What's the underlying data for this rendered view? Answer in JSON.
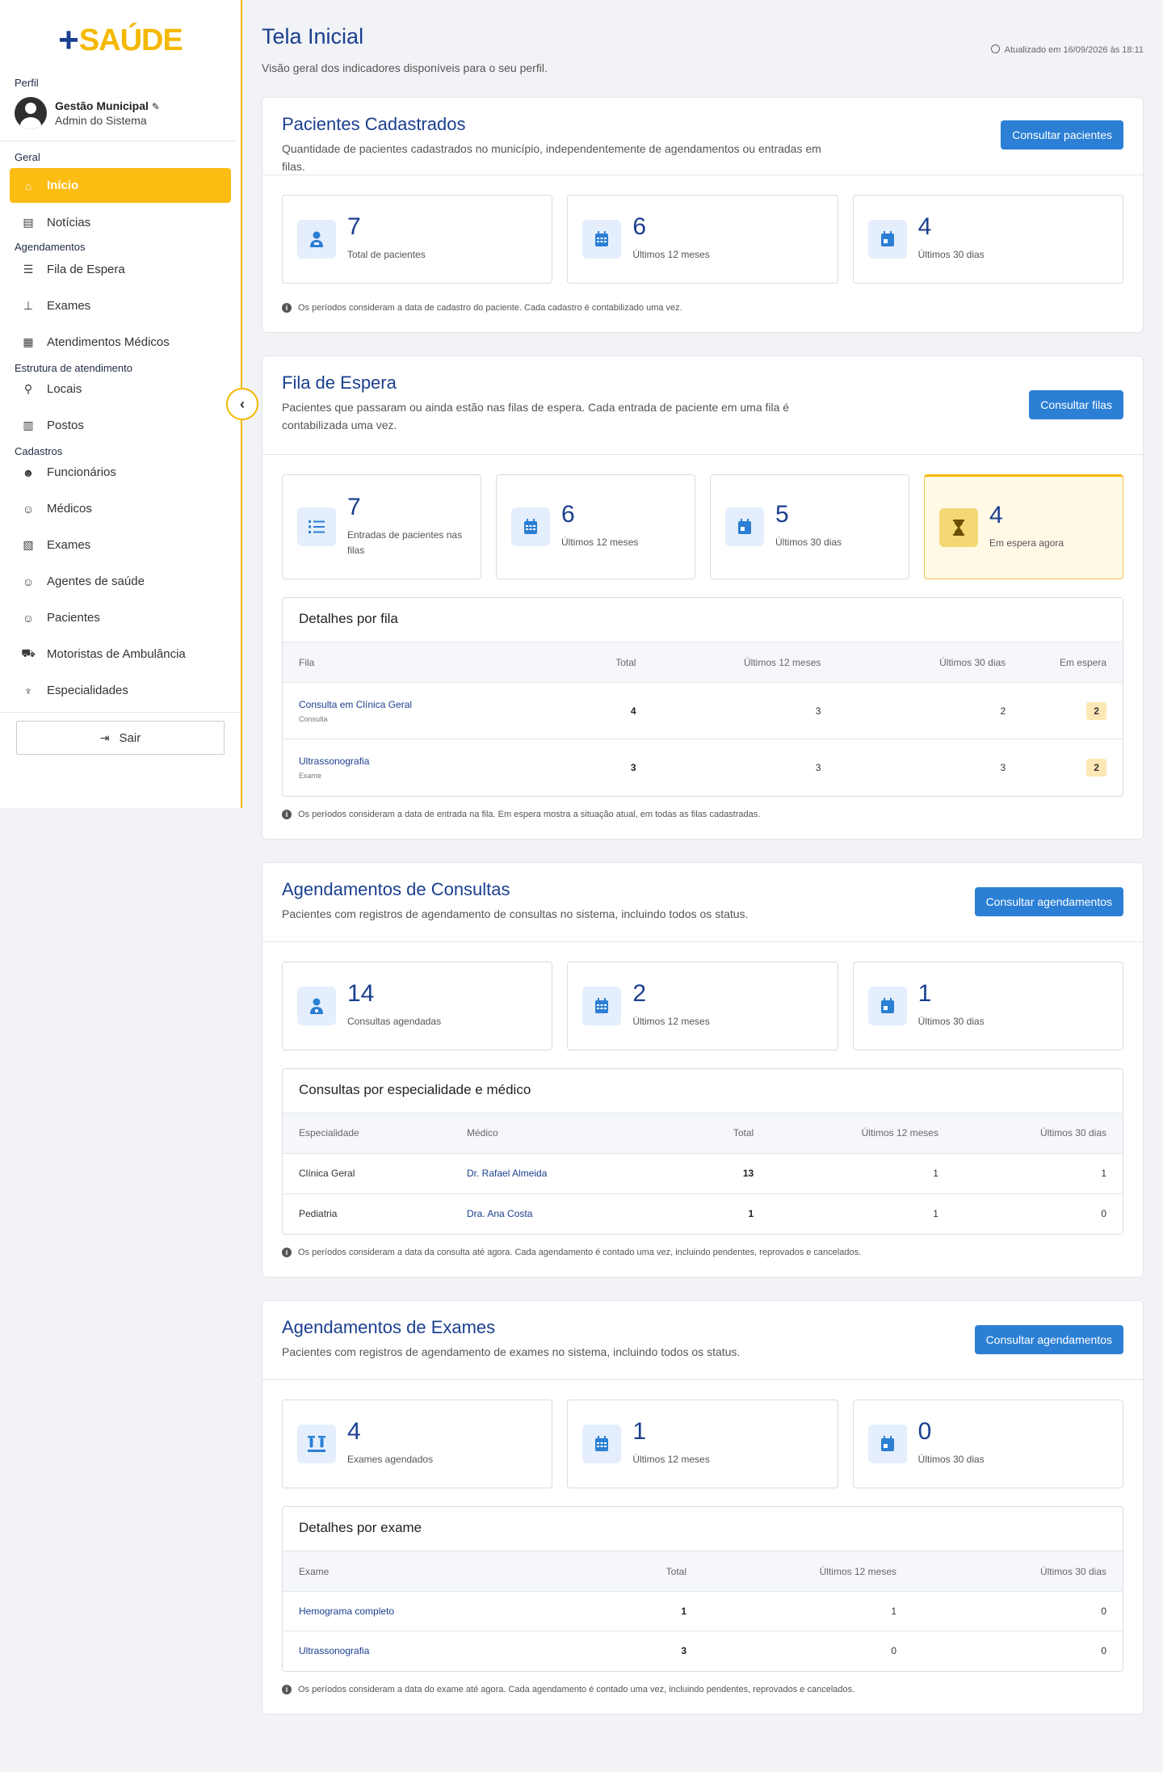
{
  "logo": {
    "plus": "+",
    "word": "SAÚDE"
  },
  "sidebar": {
    "profile_label": "Perfil",
    "profile_name": "Gestão Municipal",
    "profile_role": "Admin do Sistema",
    "sections": {
      "geral": "Geral",
      "agendamentos": "Agendamentos",
      "estrutura": "Estrutura de atendimento",
      "cadastros": "Cadastros"
    },
    "items": {
      "inicio": "Início",
      "noticias": "Notícias",
      "fila": "Fila de Espera",
      "exames": "Exames",
      "atendimentos": "Atendimentos Médicos",
      "locais": "Locais",
      "postos": "Postos",
      "funcionarios": "Funcionários",
      "medicos": "Médicos",
      "exames_cad": "Exames",
      "agentes": "Agentes de saúde",
      "pacientes": "Pacientes",
      "motoristas": "Motoristas de Ambulância",
      "especialidades": "Especialidades"
    },
    "logout": "Sair"
  },
  "header": {
    "title": "Tela Inicial",
    "subtitle": "Visão geral dos indicadores disponíveis para o seu perfil.",
    "updated": "Atualizado em 16/09/2026 às 18:11"
  },
  "pacientes": {
    "title": "Pacientes Cadastrados",
    "desc": "Quantidade de pacientes cadastrados no município, independentemente de agendamentos ou entradas em filas.",
    "button": "Consultar pacientes",
    "stats": [
      {
        "value": "7",
        "label": "Total de pacientes"
      },
      {
        "value": "6",
        "label": "Últimos 12 meses"
      },
      {
        "value": "4",
        "label": "Últimos 30 dias"
      }
    ],
    "note": "Os períodos consideram a data de cadastro do paciente. Cada cadastro é contabilizado uma vez."
  },
  "fila": {
    "title": "Fila de Espera",
    "desc": "Pacientes que passaram ou ainda estão nas filas de espera. Cada entrada de paciente em uma fila é contabilizada uma vez.",
    "button": "Consultar filas",
    "stats": [
      {
        "value": "7",
        "label": "Entradas de pacientes nas filas"
      },
      {
        "value": "6",
        "label": "Últimos 12 meses"
      },
      {
        "value": "5",
        "label": "Últimos 30 dias"
      },
      {
        "value": "4",
        "label": "Em espera agora"
      }
    ],
    "table_title": "Detalhes por fila",
    "columns": [
      "Fila",
      "Total",
      "Últimos 12 meses",
      "Últimos 30 dias",
      "Em espera"
    ],
    "rows": [
      {
        "name": "Consulta em Clínica Geral",
        "type": "Consulta",
        "total": "4",
        "m12": "3",
        "d30": "2",
        "wait": "2"
      },
      {
        "name": "Ultrassonografia",
        "type": "Exame",
        "total": "3",
        "m12": "3",
        "d30": "3",
        "wait": "2"
      }
    ],
    "note": "Os períodos consideram a data de entrada na fila. Em espera mostra a situação atual, em todas as filas cadastradas."
  },
  "consultas": {
    "title": "Agendamentos de Consultas",
    "desc": "Pacientes com registros de agendamento de consultas no sistema, incluindo todos os status.",
    "button": "Consultar agendamentos",
    "stats": [
      {
        "value": "14",
        "label": "Consultas agendadas"
      },
      {
        "value": "2",
        "label": "Últimos 12 meses"
      },
      {
        "value": "1",
        "label": "Últimos 30 dias"
      }
    ],
    "table_title": "Consultas por especialidade e médico",
    "columns": [
      "Especialidade",
      "Médico",
      "Total",
      "Últimos 12 meses",
      "Últimos 30 dias"
    ],
    "rows": [
      {
        "esp": "Clínica Geral",
        "med": "Dr. Rafael Almeida",
        "total": "13",
        "m12": "1",
        "d30": "1"
      },
      {
        "esp": "Pediatria",
        "med": "Dra. Ana Costa",
        "total": "1",
        "m12": "1",
        "d30": "0"
      }
    ],
    "note": "Os períodos consideram a data da consulta até agora. Cada agendamento é contado uma vez, incluindo pendentes, reprovados e cancelados."
  },
  "exames": {
    "title": "Agendamentos de Exames",
    "desc": "Pacientes com registros de agendamento de exames no sistema, incluindo todos os status.",
    "button": "Consultar agendamentos",
    "stats": [
      {
        "value": "4",
        "label": "Exames agendados"
      },
      {
        "value": "1",
        "label": "Últimos 12 meses"
      },
      {
        "value": "0",
        "label": "Últimos 30 dias"
      }
    ],
    "table_title": "Detalhes por exame",
    "columns": [
      "Exame",
      "Total",
      "Últimos 12 meses",
      "Últimos 30 dias"
    ],
    "rows": [
      {
        "name": "Hemograma completo",
        "total": "1",
        "m12": "1",
        "d30": "0"
      },
      {
        "name": "Ultrassonografia",
        "total": "3",
        "m12": "0",
        "d30": "0"
      }
    ],
    "note": "Os períodos consideram a data do exame até agora. Cada agendamento é contado uma vez, incluindo pendentes, reprovados e cancelados."
  },
  "colors": {
    "primary": "#1b3f8f",
    "accent": "#fcbc12",
    "button": "#2b7fd4"
  }
}
